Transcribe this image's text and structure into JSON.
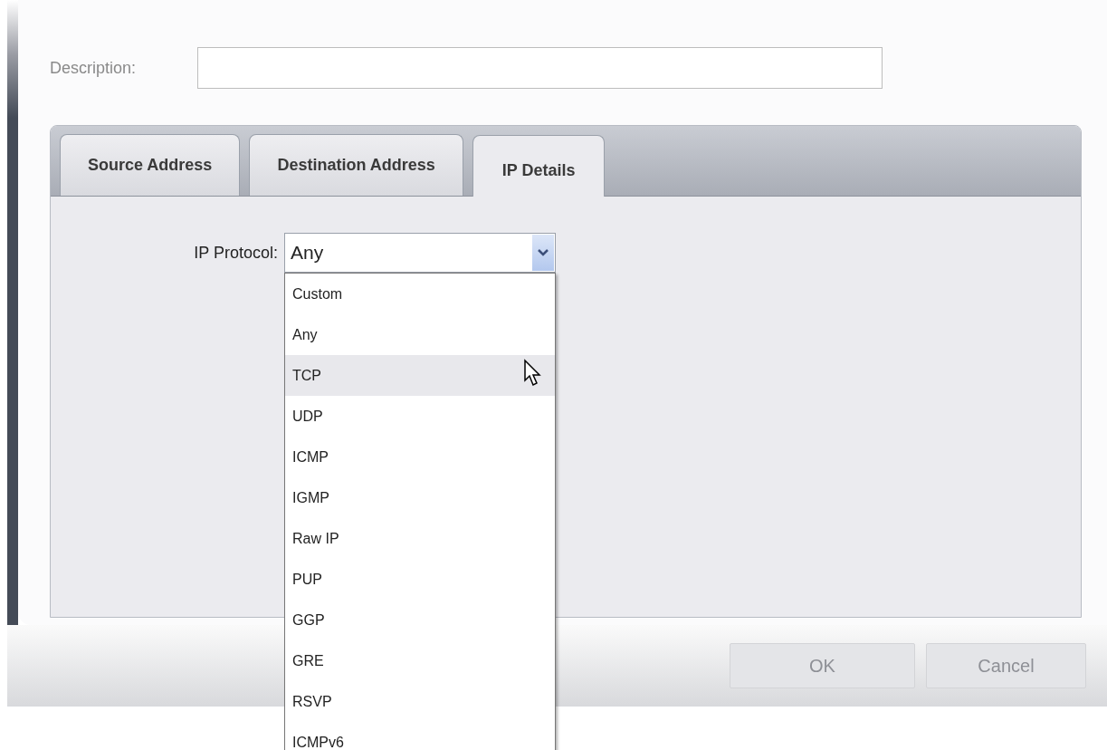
{
  "description": {
    "label": "Description:"
  },
  "tabs": [
    {
      "label": "Source Address",
      "selected": false
    },
    {
      "label": "Destination Address",
      "selected": false
    },
    {
      "label": "IP Details",
      "selected": true
    }
  ],
  "ip_protocol": {
    "label": "IP Protocol:",
    "value": "Any",
    "expanded": true,
    "options": [
      {
        "label": "Custom",
        "highlighted": false
      },
      {
        "label": "Any",
        "highlighted": false
      },
      {
        "label": "TCP",
        "highlighted": true
      },
      {
        "label": "UDP",
        "highlighted": false
      },
      {
        "label": "ICMP",
        "highlighted": false
      },
      {
        "label": "IGMP",
        "highlighted": false
      },
      {
        "label": "Raw IP",
        "highlighted": false
      },
      {
        "label": "PUP",
        "highlighted": false
      },
      {
        "label": "GGP",
        "highlighted": false
      },
      {
        "label": "GRE",
        "highlighted": false
      },
      {
        "label": "RSVP",
        "highlighted": false
      },
      {
        "label": "ICMPv6",
        "highlighted": false
      }
    ]
  },
  "buttons": [
    {
      "label": "OK",
      "disabled": true
    },
    {
      "label": "Cancel",
      "disabled": true
    }
  ]
}
